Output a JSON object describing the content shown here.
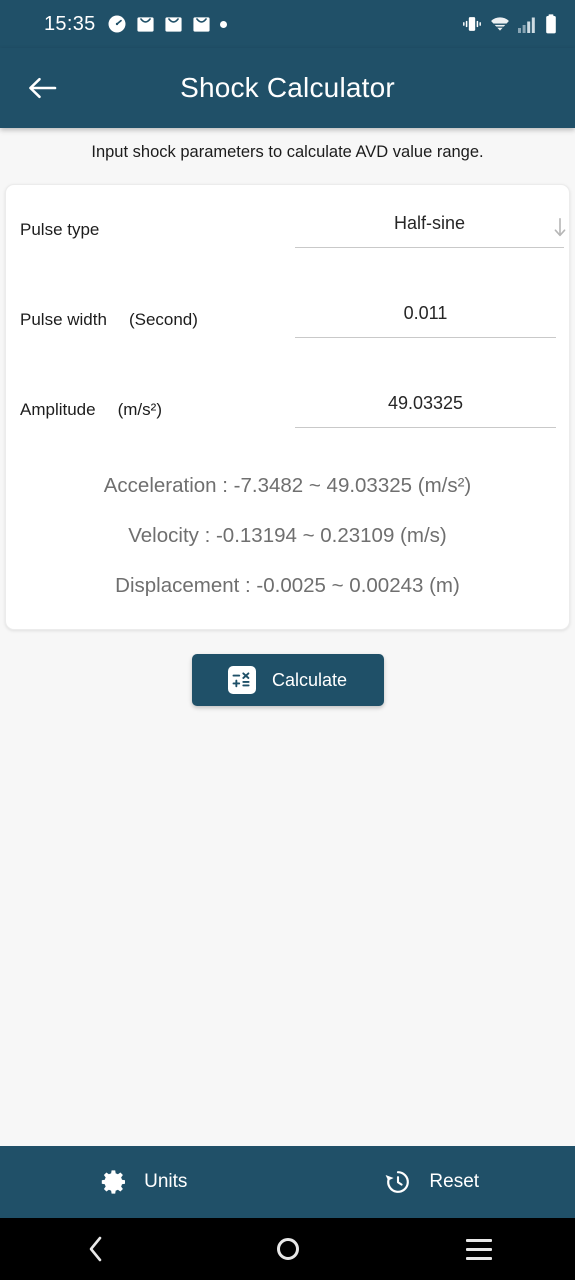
{
  "status_bar": {
    "time": "15:35",
    "left_icons": [
      "timer-icon",
      "mail-icon",
      "mail-icon",
      "mail-icon",
      "dot-indicator-icon"
    ],
    "right_icons": [
      "vibrate-icon",
      "wifi-icon",
      "cellular-signal-icon",
      "battery-icon"
    ]
  },
  "app_bar": {
    "back_icon": "back-arrow-icon",
    "title": "Shock Calculator",
    "background_color": "#205068"
  },
  "main": {
    "subtitle": "Input shock parameters to calculate AVD value range.",
    "fields": [
      {
        "label": "Pulse type",
        "unit": "",
        "value": "Half-sine",
        "type": "select",
        "dropdown_icon": "arrow-down-icon"
      },
      {
        "label": "Pulse width",
        "unit": "(Second)",
        "value": "0.011",
        "type": "number"
      },
      {
        "label": "Amplitude",
        "unit": "(m/s²)",
        "value": "49.03325",
        "type": "number"
      }
    ],
    "results": [
      "Acceleration : -7.3482 ~ 49.03325 (m/s²)",
      "Velocity : -0.13194 ~ 0.23109 (m/s)",
      "Displacement : -0.0025 ~ 0.00243 (m)"
    ],
    "calculate_button": {
      "label": "Calculate",
      "icon": "calculator-icon",
      "background_color": "#1f5068"
    }
  },
  "bottom_bar": {
    "items": [
      {
        "label": "Units",
        "icon": "gear-icon"
      },
      {
        "label": "Reset",
        "icon": "history-restore-icon"
      }
    ]
  },
  "android_nav": {
    "back": "back-chevron-icon",
    "home": "home-circle-icon",
    "recents": "recents-menu-icon"
  }
}
